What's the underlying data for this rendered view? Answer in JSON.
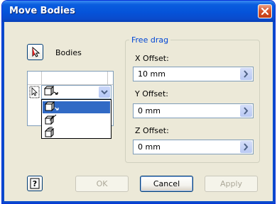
{
  "window": {
    "title": "Move Bodies"
  },
  "bodies": {
    "label": "Bodies"
  },
  "free_drag": {
    "legend": "Free drag",
    "fields": [
      {
        "label": "X Offset:",
        "value": "10 mm"
      },
      {
        "label": "Y Offset:",
        "value": "0 mm"
      },
      {
        "label": "Z Offset:",
        "value": "0 mm"
      }
    ]
  },
  "buttons": {
    "ok": "OK",
    "cancel": "Cancel",
    "apply": "Apply"
  },
  "colors": {
    "accent": "#0553d9",
    "selection": "#316ac5",
    "group_label": "#0046d5"
  }
}
